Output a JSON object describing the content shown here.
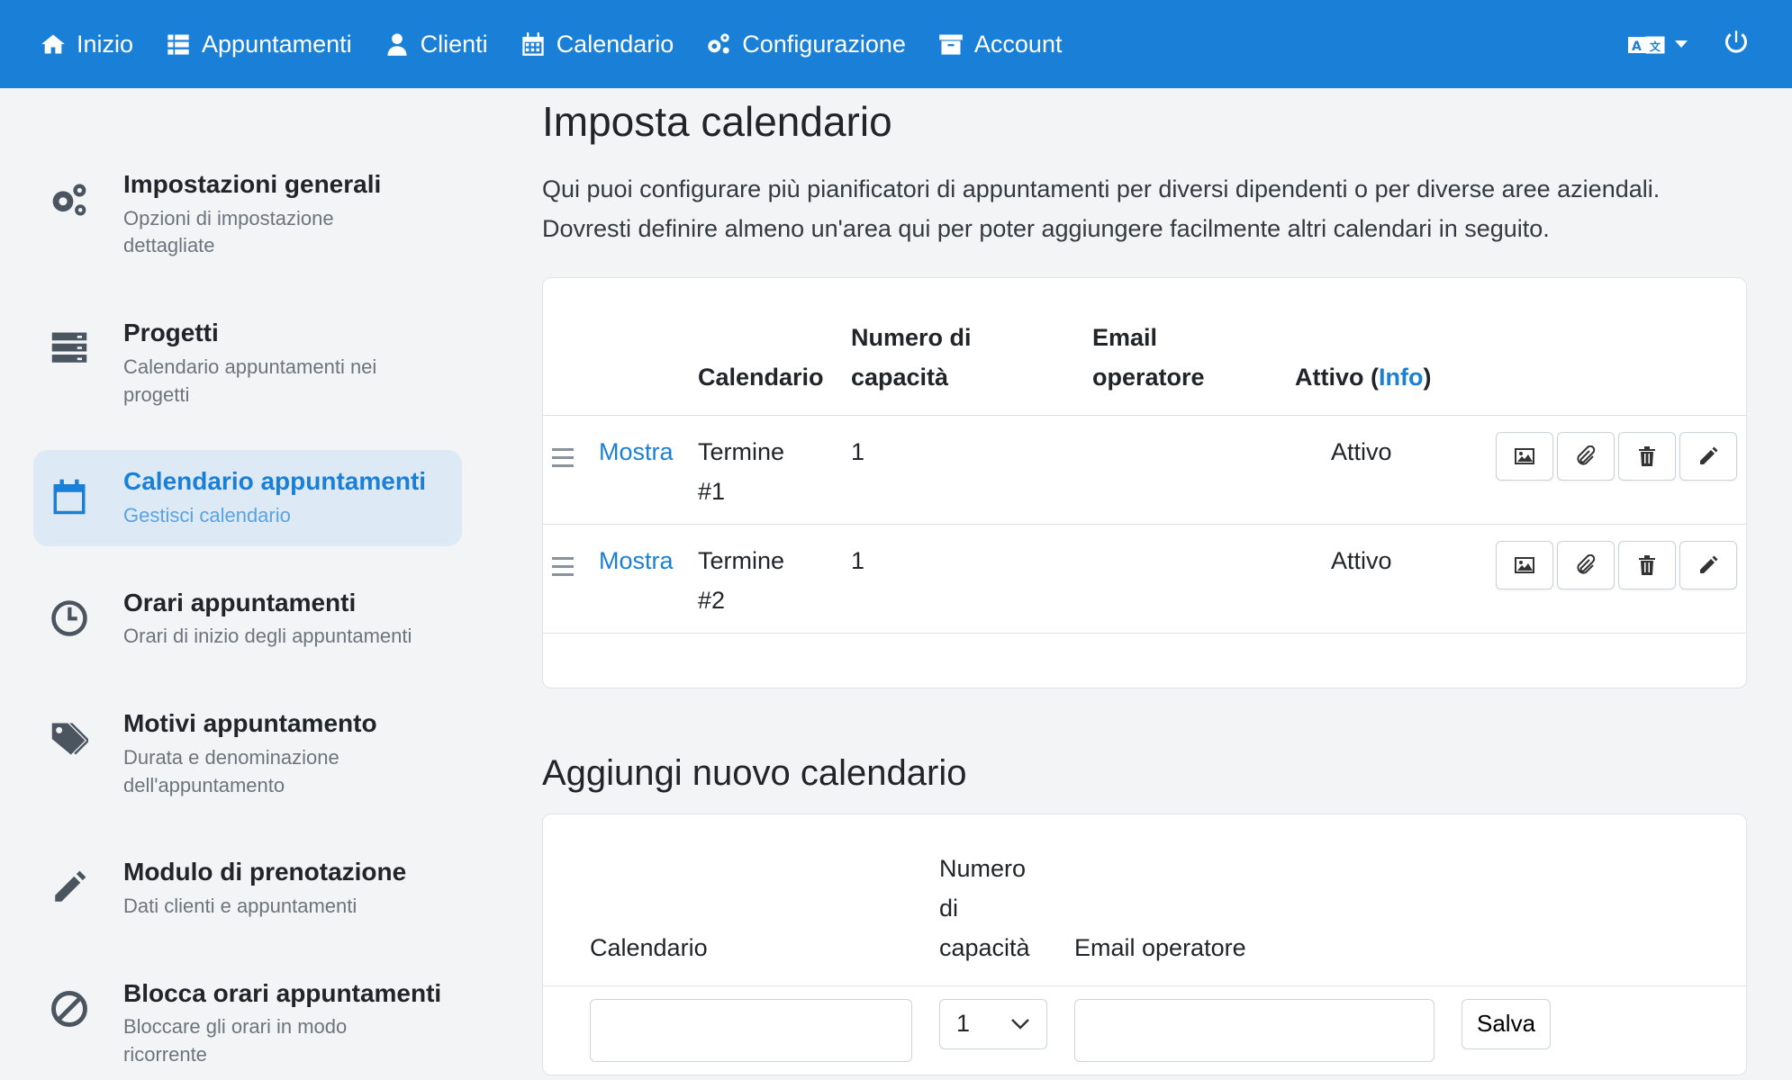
{
  "colors": {
    "primary": "#1a7fd6",
    "active_bg": "#dde9f5"
  },
  "nav": {
    "items": [
      {
        "label": "Inizio",
        "icon": "home-icon"
      },
      {
        "label": "Appuntamenti",
        "icon": "list-icon"
      },
      {
        "label": "Clienti",
        "icon": "user-icon"
      },
      {
        "label": "Calendario",
        "icon": "calendar-icon"
      },
      {
        "label": "Configurazione",
        "icon": "cogs-icon"
      },
      {
        "label": "Account",
        "icon": "archive-icon"
      }
    ],
    "right": {
      "language_icon": "translate-icon",
      "power_icon": "power-icon"
    }
  },
  "sidebar": {
    "items": [
      {
        "title": "Impostazioni generali",
        "subtitle": "Opzioni di impostazione dettagliate",
        "icon": "cogs-icon"
      },
      {
        "title": "Progetti",
        "subtitle": "Calendario appuntamenti nei progetti",
        "icon": "server-icon"
      },
      {
        "title": "Calendario appuntamenti",
        "subtitle": "Gestisci calendario",
        "icon": "calendar-icon",
        "active": true
      },
      {
        "title": "Orari appuntamenti",
        "subtitle": "Orari di inizio degli appuntamenti",
        "icon": "clock-icon"
      },
      {
        "title": "Motivi appuntamento",
        "subtitle": "Durata e denominazione dell'appuntamento",
        "icon": "tags-icon"
      },
      {
        "title": "Modulo di prenotazione",
        "subtitle": "Dati clienti e appuntamenti",
        "icon": "pencil-icon"
      },
      {
        "title": "Blocca orari appuntamenti",
        "subtitle": "Bloccare gli orari in modo ricorrente",
        "icon": "ban-icon"
      }
    ]
  },
  "main": {
    "title": "Imposta calendario",
    "intro": "Qui puoi configurare più pianificatori di appuntamenti per diversi dipendenti o per diverse aree aziendali. Dovresti definire almeno un'area qui per poter aggiungere facilmente altri calendari in seguito.",
    "table": {
      "headers": {
        "calendar": "Calendario",
        "capacity": "Numero di capacità",
        "email": "Email operatore",
        "active": "Attivo (",
        "active_info": "Info",
        "active_close": ")"
      },
      "rows": [
        {
          "show": "Mostra",
          "name": "Termine #1",
          "capacity": "1",
          "email": "",
          "status": "Attivo"
        },
        {
          "show": "Mostra",
          "name": "Termine #2",
          "capacity": "1",
          "email": "",
          "status": "Attivo"
        }
      ],
      "action_icons": [
        "image-icon",
        "paperclip-icon",
        "trash-icon",
        "pencil-icon"
      ]
    },
    "add": {
      "title": "Aggiungi nuovo calendario",
      "headers": {
        "calendar": "Calendario",
        "capacity": "Numero di capacità",
        "email": "Email operatore"
      },
      "capacity_value": "1",
      "save_label": "Salva"
    }
  }
}
